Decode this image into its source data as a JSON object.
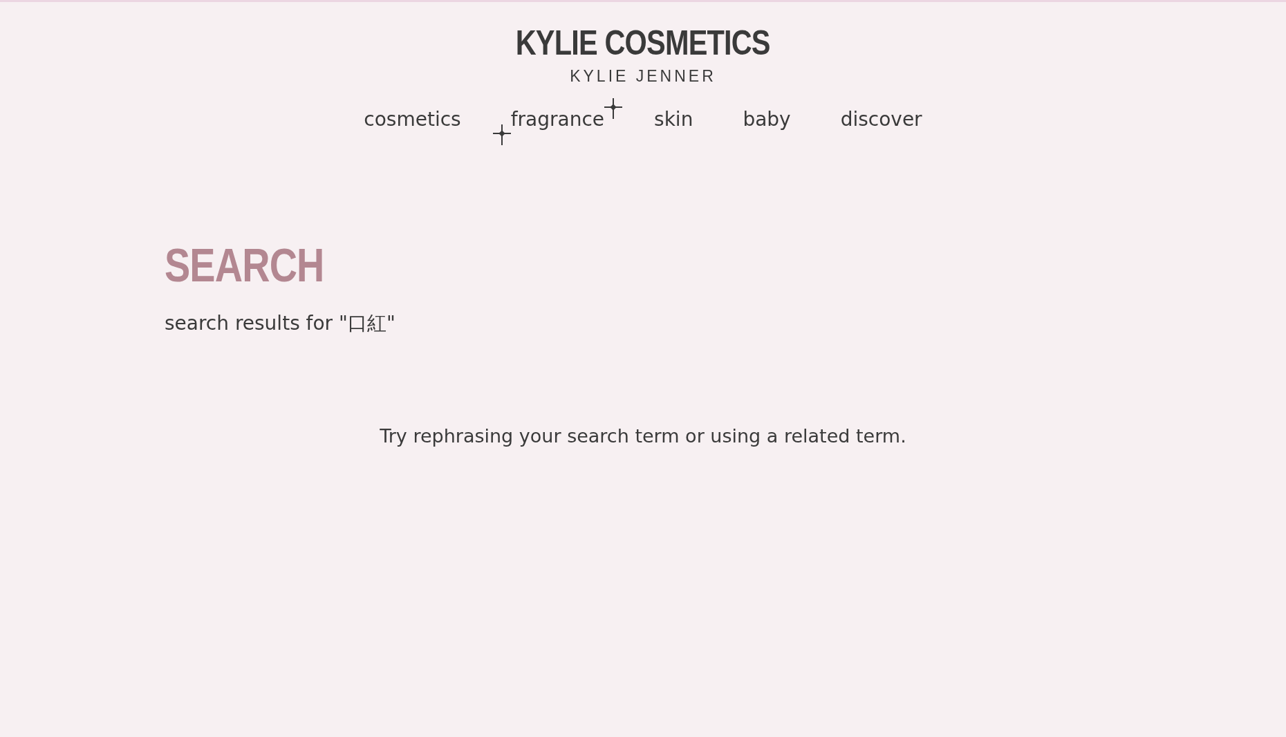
{
  "header": {
    "logo": "KYLIE COSMETICS",
    "tagline": "KYLIE JENNER"
  },
  "nav": [
    {
      "label": "cosmetics",
      "sparkle": false
    },
    {
      "label": "fragrance",
      "sparkle": true
    },
    {
      "label": "skin",
      "sparkle": false
    },
    {
      "label": "baby",
      "sparkle": false
    },
    {
      "label": "discover",
      "sparkle": false
    }
  ],
  "search": {
    "title": "SEARCH",
    "results_text": "search results for \"口紅\"",
    "message": "Try rephrasing your search term or using a related term."
  }
}
